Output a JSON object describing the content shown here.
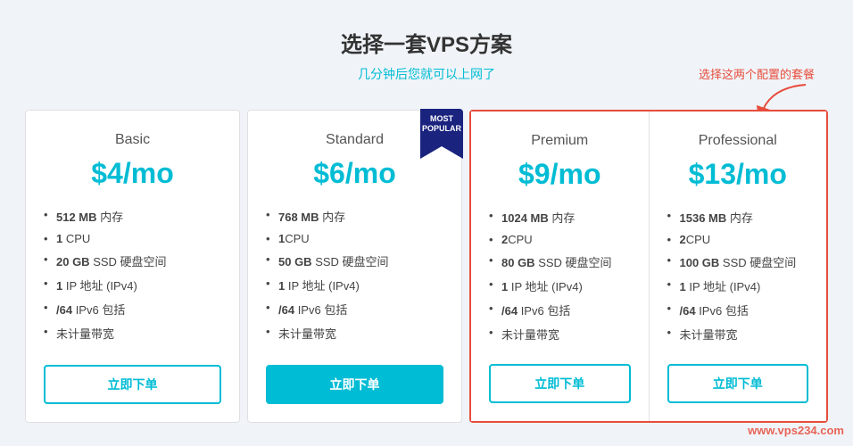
{
  "header": {
    "title": "选择一套VPS方案",
    "subtitle": "几分钟后您就可以上网了"
  },
  "annotation": {
    "text": "选择这两个配置的套餐"
  },
  "plans": [
    {
      "id": "basic",
      "name": "Basic",
      "price": "$4/mo",
      "features": [
        {
          "bold": "512 MB",
          "text": " 内存"
        },
        {
          "bold": "1",
          "text": " CPU"
        },
        {
          "bold": "20 GB",
          "text": " SSD 硬盘空间"
        },
        {
          "bold": "1",
          "text": " IP 地址 (IPv4)"
        },
        {
          "bold": "/64",
          "text": " IPv6 包括"
        },
        {
          "bold": "",
          "text": "未计量带宽"
        }
      ],
      "button": "立即下单",
      "filled": false,
      "mostPopular": false,
      "highlighted": false
    },
    {
      "id": "standard",
      "name": "Standard",
      "price": "$6/mo",
      "features": [
        {
          "bold": "768 MB",
          "text": " 内存"
        },
        {
          "bold": "1",
          "text": "CPU"
        },
        {
          "bold": "50 GB",
          "text": " SSD 硬盘空间"
        },
        {
          "bold": "1",
          "text": " IP 地址 (IPv4)"
        },
        {
          "bold": "/64",
          "text": " IPv6 包括"
        },
        {
          "bold": "",
          "text": "未计量带宽"
        }
      ],
      "button": "立即下单",
      "filled": true,
      "mostPopular": true,
      "highlighted": false
    },
    {
      "id": "premium",
      "name": "Premium",
      "price": "$9/mo",
      "features": [
        {
          "bold": "1024 MB",
          "text": " 内存"
        },
        {
          "bold": "2",
          "text": "CPU"
        },
        {
          "bold": "80 GB",
          "text": " SSD 硬盘空间"
        },
        {
          "bold": "1",
          "text": " IP 地址 (IPv4)"
        },
        {
          "bold": "/64",
          "text": " IPv6 包括"
        },
        {
          "bold": "",
          "text": "未计量带宽"
        }
      ],
      "button": "立即下单",
      "filled": false,
      "mostPopular": false,
      "highlighted": true
    },
    {
      "id": "professional",
      "name": "Professional",
      "price": "$13/mo",
      "features": [
        {
          "bold": "1536 MB",
          "text": " 内存"
        },
        {
          "bold": "2",
          "text": "CPU"
        },
        {
          "bold": "100 GB",
          "text": " SSD 硬盘空间"
        },
        {
          "bold": "1",
          "text": " IP 地址 (IPv4)"
        },
        {
          "bold": "/64",
          "text": " IPv6 包括"
        },
        {
          "bold": "",
          "text": "未计量带宽"
        }
      ],
      "button": "立即下单",
      "filled": false,
      "mostPopular": false,
      "highlighted": true
    }
  ],
  "watermark": "www.vps234.com",
  "badge": "MOST POPULAR"
}
